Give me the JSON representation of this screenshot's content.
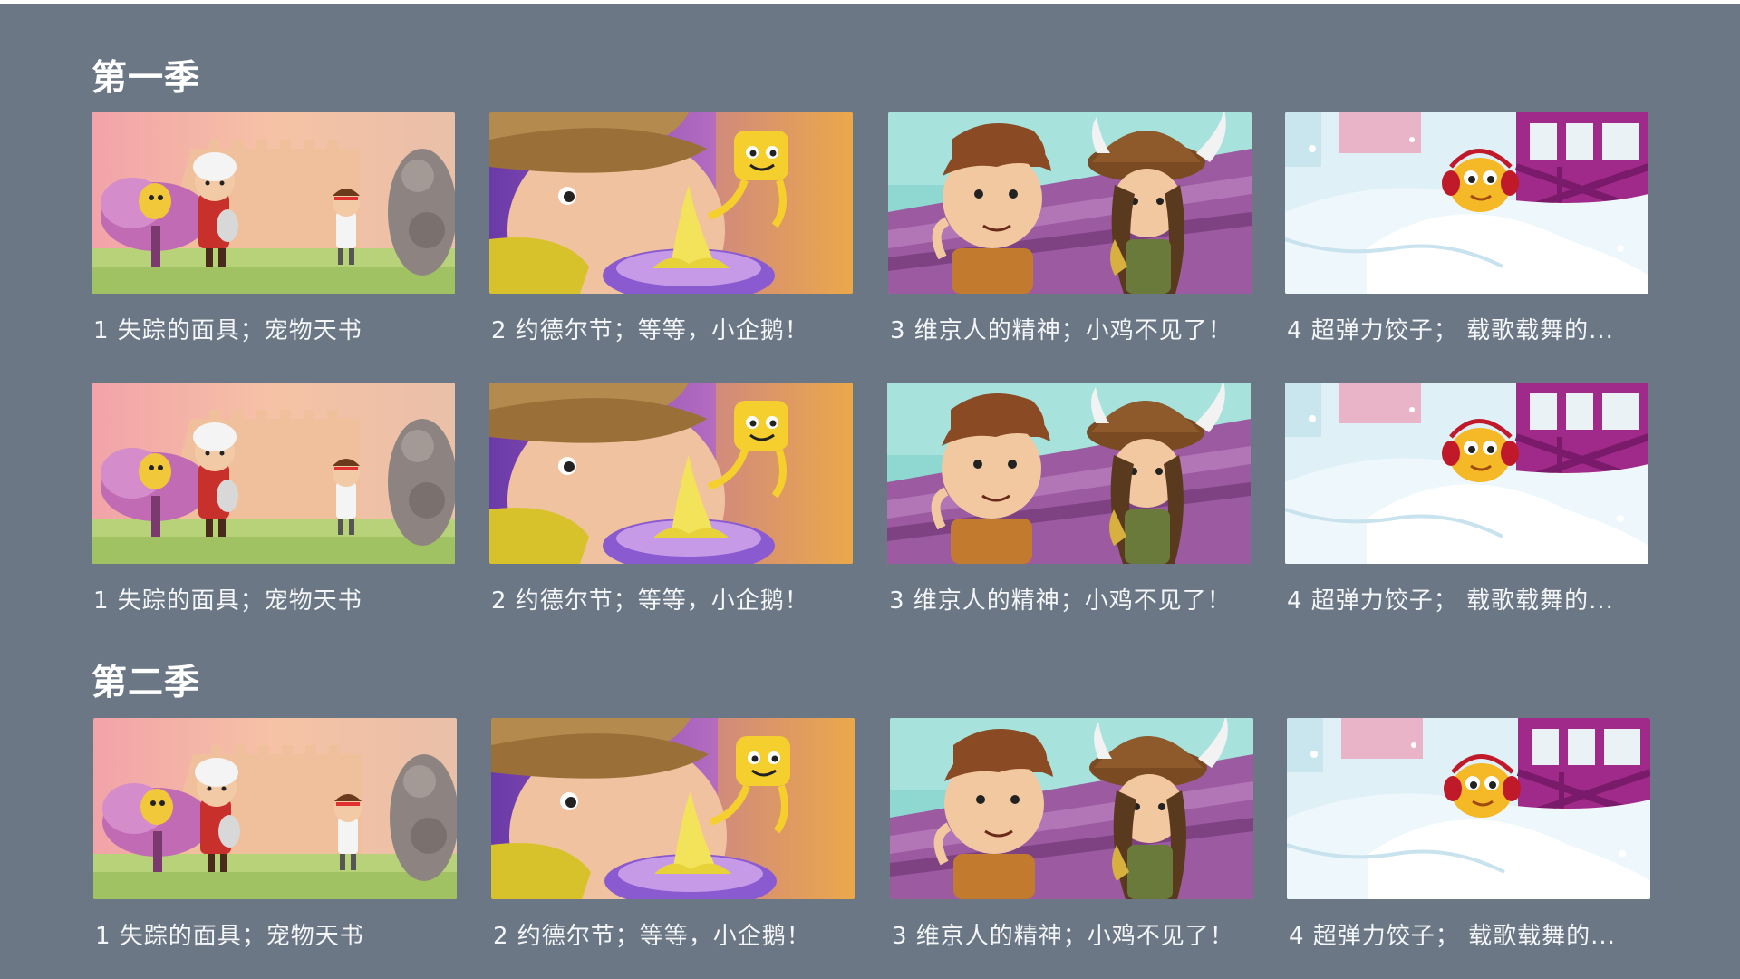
{
  "sections": [
    {
      "title": "第一季",
      "rows": [
        [
          {
            "label": "1 失踪的面具；宠物天书",
            "scene": "castle"
          },
          {
            "label": "2 约德尔节；等等，小企鹅！",
            "scene": "banana"
          },
          {
            "label": "3 维京人的精神；小鸡不见了！",
            "scene": "viking"
          },
          {
            "label": "4 超弹力饺子； 载歌载舞的...",
            "scene": "snow"
          }
        ],
        [
          {
            "label": "1 失踪的面具；宠物天书",
            "scene": "castle"
          },
          {
            "label": "2 约德尔节；等等，小企鹅！",
            "scene": "banana"
          },
          {
            "label": "3 维京人的精神；小鸡不见了！",
            "scene": "viking"
          },
          {
            "label": "4 超弹力饺子； 载歌载舞的...",
            "scene": "snow"
          }
        ]
      ]
    },
    {
      "title": "第二季",
      "rows": [
        [
          {
            "label": "1 失踪的面具；宠物天书",
            "scene": "castle"
          },
          {
            "label": "2 约德尔节；等等，小企鹅！",
            "scene": "banana"
          },
          {
            "label": "3 维京人的精神；小鸡不见了！",
            "scene": "viking"
          },
          {
            "label": "4 超弹力饺子； 载歌载舞的...",
            "scene": "snow"
          }
        ]
      ]
    }
  ],
  "colors": {
    "background": "#6b7785",
    "text": "#ffffff"
  }
}
